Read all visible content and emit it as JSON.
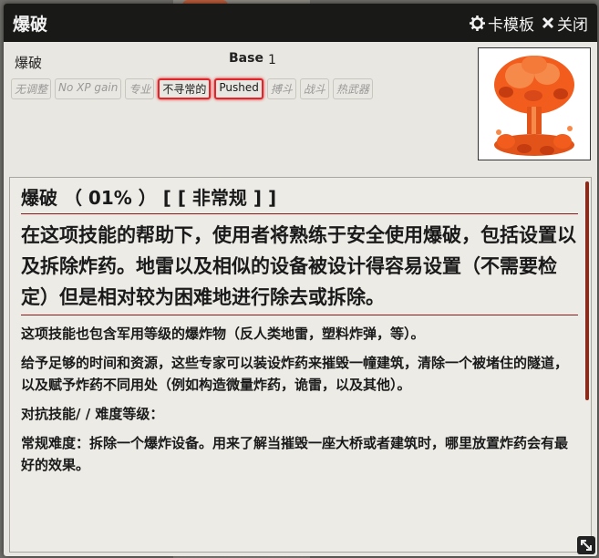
{
  "window": {
    "title": "爆破",
    "card_mode_label": "卡模板",
    "close_label": "关闭"
  },
  "item": {
    "name": "爆破",
    "base_label": "Base",
    "base_value": "1"
  },
  "tags": [
    {
      "label": "无调整",
      "active": false
    },
    {
      "label": "No XP gain",
      "active": false
    },
    {
      "label": "专业",
      "active": false
    },
    {
      "label": "不寻常的",
      "active": true
    },
    {
      "label": "Pushed",
      "active": true
    },
    {
      "label": "搏斗",
      "active": false
    },
    {
      "label": "战斗",
      "active": false
    },
    {
      "label": "热武器",
      "active": false
    }
  ],
  "description": {
    "heading": "爆破 （ 01% ） [ [ 非常规 ] ]",
    "lead": "在这项技能的帮助下，使用者将熟练于安全使用爆破，包括设置以及拆除炸药。地雷以及相似的设备被设计得容易设置（不需要检定）但是相对较为困难地进行除去或拆除。",
    "paragraphs": [
      "这项技能也包含军用等级的爆炸物（反人类地雷，塑料炸弹，等）。",
      "给予足够的时间和资源，这些专家可以装设炸药来摧毁一幢建筑，清除一个被堵住的隧道，以及赋予炸药不同用处（例如构造微量炸药，诡雷，以及其他）。",
      "对抗技能/ / 难度等级：",
      "常规难度：拆除一个爆炸设备。用来了解当摧毁一座大桥或者建筑时，哪里放置炸药会有最好的效果。"
    ]
  },
  "colors": {
    "titlebar": "#191918",
    "accent_red": "#e0252b",
    "explosion_orange": "#f25c1c"
  }
}
